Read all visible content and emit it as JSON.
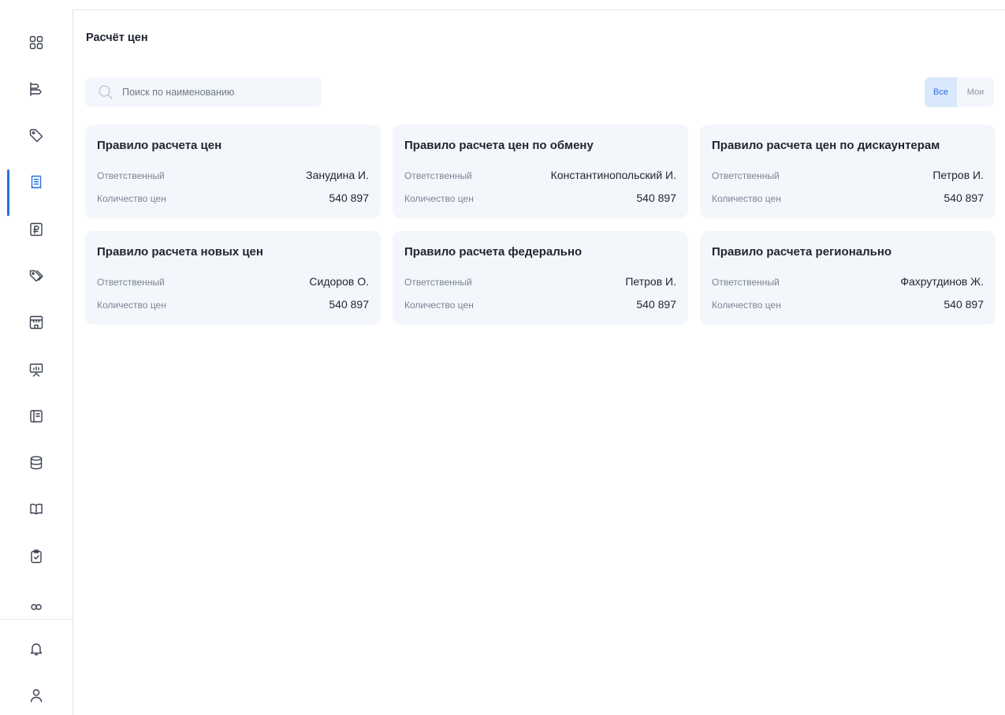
{
  "page": {
    "title": "Расчёт цен"
  },
  "search": {
    "placeholder": "Поиск по наименованию"
  },
  "filter_toggle": {
    "all_label": "Все",
    "mine_label": "Мои",
    "selected": "Все"
  },
  "colors": {
    "accent": "#2b6fe0",
    "card_bg": "#f3f7fc",
    "toggle_active_bg": "#d9e8fc"
  },
  "sidebar": {
    "items": [
      {
        "icon": "grid-icon"
      },
      {
        "icon": "hierarchy-icon"
      },
      {
        "icon": "tag-icon"
      },
      {
        "icon": "receipt-icon",
        "active": true
      },
      {
        "icon": "ruble-icon"
      },
      {
        "icon": "tags-icon"
      },
      {
        "icon": "store-icon"
      },
      {
        "icon": "presentation-icon"
      },
      {
        "icon": "document-icon"
      },
      {
        "icon": "database-icon"
      },
      {
        "icon": "book-icon"
      },
      {
        "icon": "clipboard-check-icon"
      },
      {
        "icon": "users-icon"
      }
    ],
    "bottom": [
      {
        "icon": "bell-icon"
      },
      {
        "icon": "user-icon"
      }
    ]
  },
  "cards": [
    {
      "title": "Правило расчета цен",
      "responsible_label": "Ответственный",
      "responsible": "Занудина И.",
      "count_label": "Количество цен",
      "count": "540 897"
    },
    {
      "title": "Правило расчета цен по обмену",
      "responsible_label": "Ответственный",
      "responsible": "Константинопольский И.",
      "count_label": "Количество цен",
      "count": "540 897"
    },
    {
      "title": "Правило расчета цен  по дискаунтерам",
      "responsible_label": "Ответственный",
      "responsible": "Петров И.",
      "count_label": "Количество цен",
      "count": "540 897"
    },
    {
      "title": "Правило расчета новых цен",
      "responsible_label": "Ответственный",
      "responsible": "Сидоров О.",
      "count_label": "Количество цен",
      "count": "540 897"
    },
    {
      "title": "Правило расчета федерально",
      "responsible_label": "Ответственный",
      "responsible": "Петров И.",
      "count_label": "Количество цен",
      "count": "540 897"
    },
    {
      "title": "Правило расчета регионально",
      "responsible_label": "Ответственный",
      "responsible": "Фахрутдинов Ж.",
      "count_label": "Количество цен",
      "count": "540 897"
    }
  ]
}
